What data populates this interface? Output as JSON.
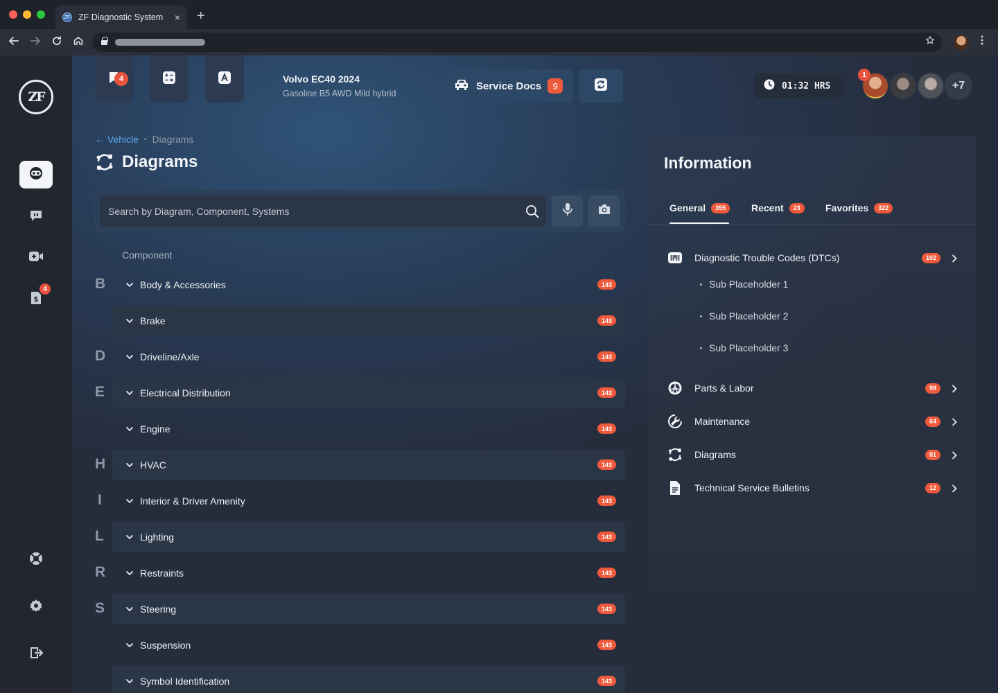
{
  "browser": {
    "tab_title": "ZF Diagnostic System",
    "tab_favicon_text": "ZF",
    "tab_close": "×",
    "new_tab": "+"
  },
  "sidebar": {
    "logo_text": "ZF",
    "badge": "4",
    "items": [
      {
        "icon": "obd-icon",
        "active": true
      },
      {
        "icon": "chat-icon",
        "active": false
      },
      {
        "icon": "video-icon",
        "active": false
      },
      {
        "icon": "invoice-icon",
        "active": false
      },
      {
        "icon": "support-icon",
        "active": false
      },
      {
        "icon": "gear-icon",
        "active": false
      },
      {
        "icon": "logout-icon",
        "active": false
      }
    ]
  },
  "toolbar": {
    "bookmark_badge": "4",
    "vehicle_name": "Volvo EC40 2024",
    "vehicle_sub": "Gasoline B5 AWD Mild hybrid",
    "service_label": "Service Docs",
    "service_count": "9",
    "timer": "01:32 HRS",
    "avatar_badge": "1",
    "avatar_more": "+7"
  },
  "breadcrumb": {
    "back_label": "← Vehicle",
    "dot": "•",
    "current": "Diagrams"
  },
  "page_title": "Diagrams",
  "search": {
    "placeholder": "Search by Diagram, Component, Systems"
  },
  "components": {
    "header": "Component",
    "letters": [
      "B",
      "D",
      "E",
      "H",
      "I",
      "L",
      "R",
      "S"
    ],
    "rows": [
      {
        "label": "Body & Accessories",
        "count": "143"
      },
      {
        "label": "Brake",
        "count": "143"
      },
      {
        "label": "Driveline/Axle",
        "count": "143"
      },
      {
        "label": "Electrical Distribution",
        "count": "143"
      },
      {
        "label": "Engine",
        "count": "143"
      },
      {
        "label": "HVAC",
        "count": "143"
      },
      {
        "label": "Interior & Driver Amenity",
        "count": "143"
      },
      {
        "label": "Lighting",
        "count": "143"
      },
      {
        "label": "Restraints",
        "count": "143"
      },
      {
        "label": "Steering",
        "count": "143"
      },
      {
        "label": "Suspension",
        "count": "143"
      },
      {
        "label": "Symbol Identification",
        "count": "143"
      }
    ]
  },
  "info": {
    "title": "Information",
    "tabs": [
      {
        "label": "General",
        "count": "355"
      },
      {
        "label": "Recent",
        "count": "23"
      },
      {
        "label": "Favorites",
        "count": "322"
      }
    ],
    "items": [
      {
        "label": "Diagnostic Trouble Codes (DTCs)",
        "count": "102",
        "icon": "dtc-icon"
      },
      {
        "label": "Parts & Labor",
        "count": "98",
        "icon": "wheel-icon"
      },
      {
        "label": "Maintenance",
        "count": "64",
        "icon": "wrench-icon"
      },
      {
        "label": "Diagrams",
        "count": "81",
        "icon": "diagram-icon"
      },
      {
        "label": "Technical Service Bulletins",
        "count": "12",
        "icon": "document-icon"
      }
    ],
    "sub_items": [
      "Sub Placeholder 1",
      "Sub Placeholder 2",
      "Sub Placeholder 3"
    ]
  },
  "colors": {
    "accent_badge": "#ef5a3c",
    "link": "#5fa7ea",
    "sidebar": "#23262e"
  }
}
